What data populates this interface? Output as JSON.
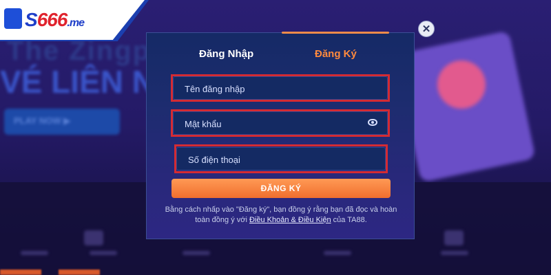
{
  "logo": {
    "brand_prefix": "S",
    "brand_number": "666",
    "brand_suffix": ".me"
  },
  "background": {
    "banner_line1": "The Zingpla",
    "banner_line2": "VÉ LIÊN N",
    "banner_button": "PLAY NOW ▶"
  },
  "modal": {
    "tabs": {
      "login": "Đăng Nhập",
      "register": "Đăng Ký",
      "active": "register"
    },
    "fields": {
      "username_placeholder": "Tên đăng nhập",
      "password_placeholder": "Mật khẩu",
      "phone_placeholder": "Số điện thoại"
    },
    "submit_label": "ĐĂNG KÝ",
    "terms": {
      "text_before": "Bằng cách nhấp vào \"Đăng ký\", bạn đồng ý rằng bạn đã đọc và hoàn toàn đồng ý với ",
      "link_text": "Điều Khoản & Điều Kiện",
      "text_after": " của TA88."
    },
    "close_label": "✕"
  },
  "colors": {
    "accent_orange": "#f07a34",
    "highlight_red": "#d42b33",
    "modal_bg": "#1d2c6f"
  }
}
